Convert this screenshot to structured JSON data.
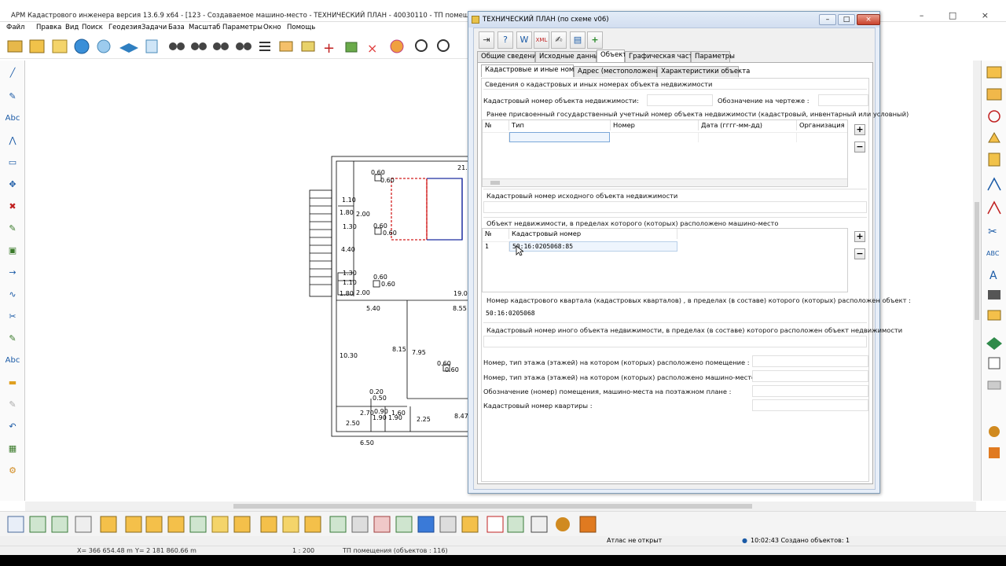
{
  "app": {
    "title": "АРМ Кадастрового инженера версия 13.6.9 x64 - [123 - Создаваемое машино-место - ТЕХНИЧЕСКИЙ ПЛАН - 40030110 - ТП помещения]",
    "menu": [
      "Файл",
      "Правка",
      "Вид",
      "Поиск",
      "Геодезия",
      "Задачи",
      "База",
      "Масштаб",
      "Параметры",
      "Окно",
      "Помощь"
    ],
    "window_buttons": [
      "–",
      "□",
      "×"
    ]
  },
  "drawing": {
    "labels": [
      "0.60",
      "0.60",
      "21.8",
      "1.10",
      "1.80",
      "2.00",
      "0.60",
      "0.60",
      "1.30",
      "4.40",
      "1.30",
      "1.10",
      "0.60",
      "0.60",
      "1.80",
      "2.00",
      "19.00",
      "5.40",
      "8.55",
      "8.15",
      "7.95",
      "10.30",
      "0.60",
      "0.60",
      "0.20",
      "0.50",
      "2.70",
      "0.90",
      "1.60",
      "1.90",
      "1.90",
      "2.25",
      "8.47",
      "2.50",
      "6.50"
    ]
  },
  "dialog": {
    "title": "ТЕХНИЧЕСКИЙ ПЛАН (по схеме v06)",
    "main_tabs": [
      "Общие сведения",
      "Исходные данные",
      "Объект",
      "Графическая часть",
      "Параметры"
    ],
    "active_main_tab": "Объект",
    "sub_tabs": [
      "Кадастровые и иные номера",
      "Адрес (местоположение)",
      "Характеристики объекта"
    ],
    "active_sub_tab": "Кадастровые и иные номера",
    "section_header": "Сведения о кадастровых и иных номерах объекта  недвижимости",
    "cadastral_number_label": "Кадастровый номер объекта недвижимости:",
    "cadastral_number_value": "",
    "drawing_designation_label": "Обозначение на чертеже :",
    "drawing_designation_value": "",
    "prev_numbers": {
      "header": "Ранее присвоенный государственный учетный номер объекта недвижимости (кадастровый, инвентарный или условный)",
      "columns": [
        "№",
        "Тип",
        "Номер",
        "Дата (гггг-мм-дд)",
        "Организация"
      ]
    },
    "source_object_label": "Кадастровый номер исходного объекта недвижимости",
    "parent_objects": {
      "header": "Объект недвижимости, в пределах которого (которых) расположено машино-место",
      "columns": [
        "№",
        "Кадастровый номер"
      ],
      "rows": [
        {
          "num": "1",
          "cad": "50:16:0205068:85"
        }
      ]
    },
    "quarter": {
      "label": "Номер кадастрового квартала (кадастровых кварталов) , в пределах (в составе) которого (которых) расположен объект :",
      "value": "50:16:0205068"
    },
    "other_object_label": "Кадастровый номер иного объекта недвижимости, в пределах (в составе) которого расположен объект недвижимости",
    "floor_room_label": "Номер, тип этажа (этажей) на котором (которых) расположено помещение :",
    "floor_parking_label": "Номер, тип этажа (этажей) на котором (которых) расположено машино-место :",
    "designation_plan_label": "Обозначение (номер) помещения, машино-места на поэтажном плане :",
    "apartment_label": "Кадастровый номер квартиры :",
    "add_symbol": "+",
    "remove_symbol": "−"
  },
  "status": {
    "atlas": "Атлас не открыт",
    "time_info": "10:02:43  Создано объектов: 1",
    "x": "X=   366 654.48 m",
    "y": "Y= 2 181 860.66 m",
    "scale": "1 : 200",
    "layer": "ТП помещения  (объектов : 116)"
  },
  "colors": {
    "accent": "#1a5aa6",
    "red_dashed": "#d21f1f",
    "blue_line": "#1f2fa0"
  }
}
